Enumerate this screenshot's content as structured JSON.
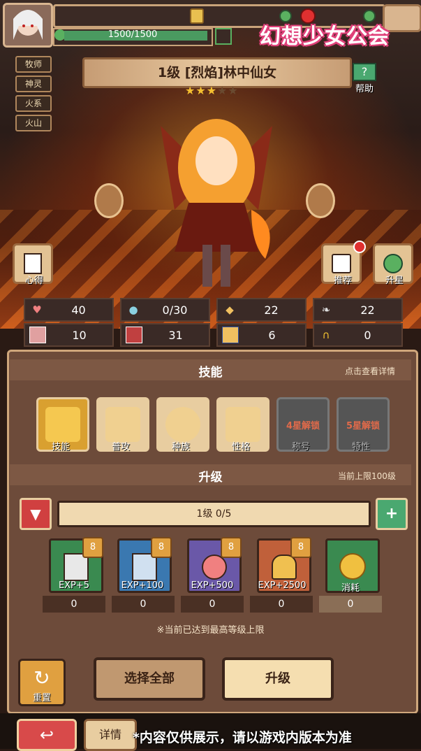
{
  "header": {
    "hp_text": "1500/1500",
    "logo_text": "幻想少女公会"
  },
  "tags": [
    "牧师",
    "神灵",
    "火系",
    "火山"
  ],
  "hero": {
    "title": "1级 [烈焰]林中仙女",
    "stars_filled": 3,
    "stars_total": 5,
    "help_label": "帮助"
  },
  "side_buttons": {
    "insight_label": "心得",
    "recommend_label": "推荐",
    "star_up_label": "升星"
  },
  "stats": [
    {
      "icon": "heart-icon",
      "value": "40"
    },
    {
      "icon": "water-drop-icon",
      "value": "0/30"
    },
    {
      "icon": "shield-icon",
      "value": "22"
    },
    {
      "icon": "wing-icon",
      "value": "22"
    },
    {
      "icon": "fist-icon",
      "value": "10"
    },
    {
      "icon": "book-icon",
      "value": "31"
    },
    {
      "icon": "scroll-icon",
      "value": "6"
    },
    {
      "icon": "horseshoe-icon",
      "value": "0"
    }
  ],
  "skills_section": {
    "title": "技能",
    "hint": "点击查看详情",
    "items": [
      {
        "label": "技能",
        "locked": false,
        "lock_text": ""
      },
      {
        "label": "普攻",
        "locked": false,
        "lock_text": ""
      },
      {
        "label": "种族",
        "locked": false,
        "lock_text": ""
      },
      {
        "label": "性格",
        "locked": false,
        "lock_text": ""
      },
      {
        "label": "称号",
        "locked": true,
        "lock_text": "4星解锁"
      },
      {
        "label": "特性",
        "locked": true,
        "lock_text": "5星解锁"
      }
    ]
  },
  "upgrade_section": {
    "title": "升级",
    "hint": "当前上限100级",
    "level_text": "1级 0/5",
    "items": [
      {
        "label": "EXP+5",
        "count": "0",
        "badge": "8"
      },
      {
        "label": "EXP+100",
        "count": "0",
        "badge": "8"
      },
      {
        "label": "EXP+500",
        "count": "0",
        "badge": "8"
      },
      {
        "label": "EXP+2500",
        "count": "0",
        "badge": "8"
      },
      {
        "label": "消耗",
        "count": "0",
        "badge": ""
      }
    ],
    "note": "※当前已达到最高等级上限"
  },
  "actions": {
    "reset_label": "重置",
    "select_all_label": "选择全部",
    "upgrade_label": "升级"
  },
  "bottom": {
    "details_label": "详情",
    "disclaimer": "*内容仅供展示，请以游戏内版本为准"
  },
  "colors": {
    "panel": "#6d4b3a",
    "accent": "#cfa77c",
    "hp": "#4a9a60",
    "logo_outline": "#e0407a"
  }
}
